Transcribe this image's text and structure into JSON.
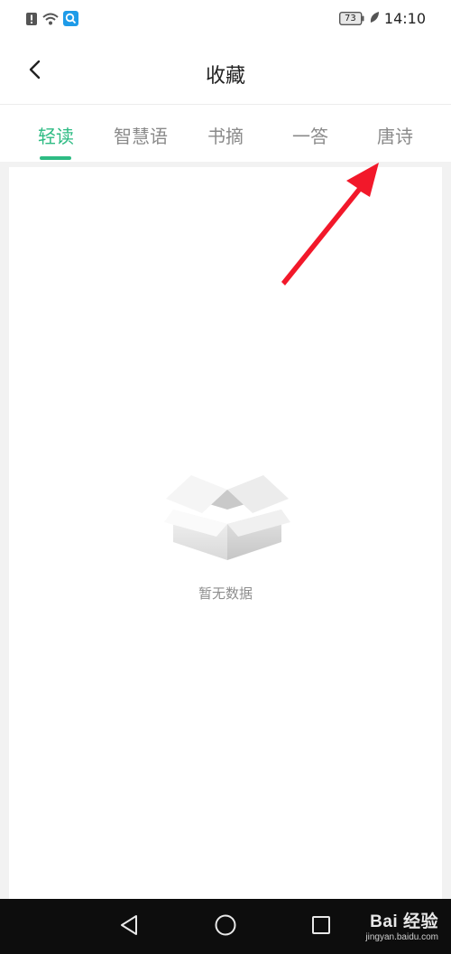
{
  "status_bar": {
    "time": "14:10",
    "battery": "73"
  },
  "header": {
    "title": "收藏"
  },
  "tabs": [
    {
      "label": "轻读",
      "active": true
    },
    {
      "label": "智慧语",
      "active": false
    },
    {
      "label": "书摘",
      "active": false
    },
    {
      "label": "一答",
      "active": false
    },
    {
      "label": "唐诗",
      "active": false
    }
  ],
  "empty_state": {
    "text": "暂无数据"
  },
  "watermark": {
    "main": "Bai 经验",
    "sub": "jingyan.baidu.com"
  },
  "colors": {
    "accent": "#2dbb83",
    "annotation_arrow": "#f2182a"
  },
  "icons": {
    "back": "back-arrow-icon",
    "nav_back": "triangle-back-icon",
    "nav_home": "circle-home-icon",
    "nav_recent": "square-recent-icon"
  }
}
